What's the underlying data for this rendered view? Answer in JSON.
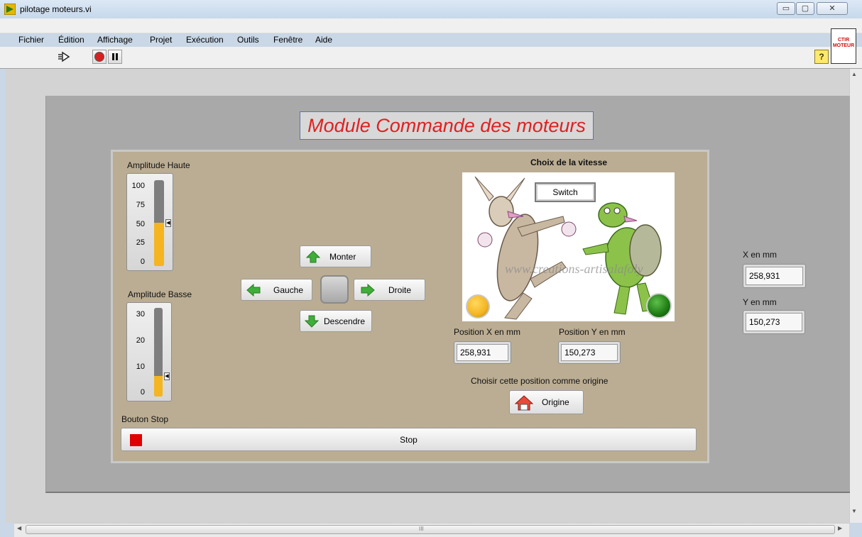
{
  "window": {
    "title": "pilotage moteurs.vi",
    "controls": {
      "minimize": "▭",
      "maximize": "▢",
      "close": "✕"
    }
  },
  "menu": [
    "Fichier",
    "Édition",
    "Affichage",
    "Projet",
    "Exécution",
    "Outils",
    "Fenêtre",
    "Aide"
  ],
  "toolbar": {
    "help": "?",
    "vi_icon_text": "CTIR\nMOTEUR"
  },
  "panel": {
    "title": "Module Commande des moteurs",
    "amplitude_haute": {
      "label": "Amplitude Haute",
      "ticks": [
        "100",
        "75",
        "50",
        "25",
        "0"
      ],
      "value": 50,
      "max": 100
    },
    "amplitude_basse": {
      "label": "Amplitude Basse",
      "ticks": [
        "30",
        "20",
        "10",
        "0"
      ],
      "value": 7,
      "max": 30
    },
    "buttons": {
      "up": "Monter",
      "left": "Gauche",
      "right": "Droite",
      "down": "Descendre"
    },
    "speed": {
      "label": "Choix de la vitesse",
      "switch": "Switch",
      "watermark": "www.creations-artisalafoly"
    },
    "position_x": {
      "label": "Position X en mm",
      "value": "258,931"
    },
    "position_y": {
      "label": "Position Y en mm",
      "value": "150,273"
    },
    "origin": {
      "label": "Choisir cette position comme origine",
      "button": "Origine"
    },
    "stop": {
      "label": "Bouton Stop",
      "button": "Stop"
    },
    "x_mm": {
      "label": "X en mm",
      "value": "258,931"
    },
    "y_mm": {
      "label": "Y en mm",
      "value": "150,273"
    }
  },
  "scrollbar": {
    "grip": "III"
  },
  "colors": {
    "accent_title": "#e02020",
    "slider_fill": "#f4b520",
    "led_on": "#f4b520",
    "led_green": "#1f7a14",
    "stop_square": "#e00000",
    "panel_tan": "#bbad93"
  }
}
